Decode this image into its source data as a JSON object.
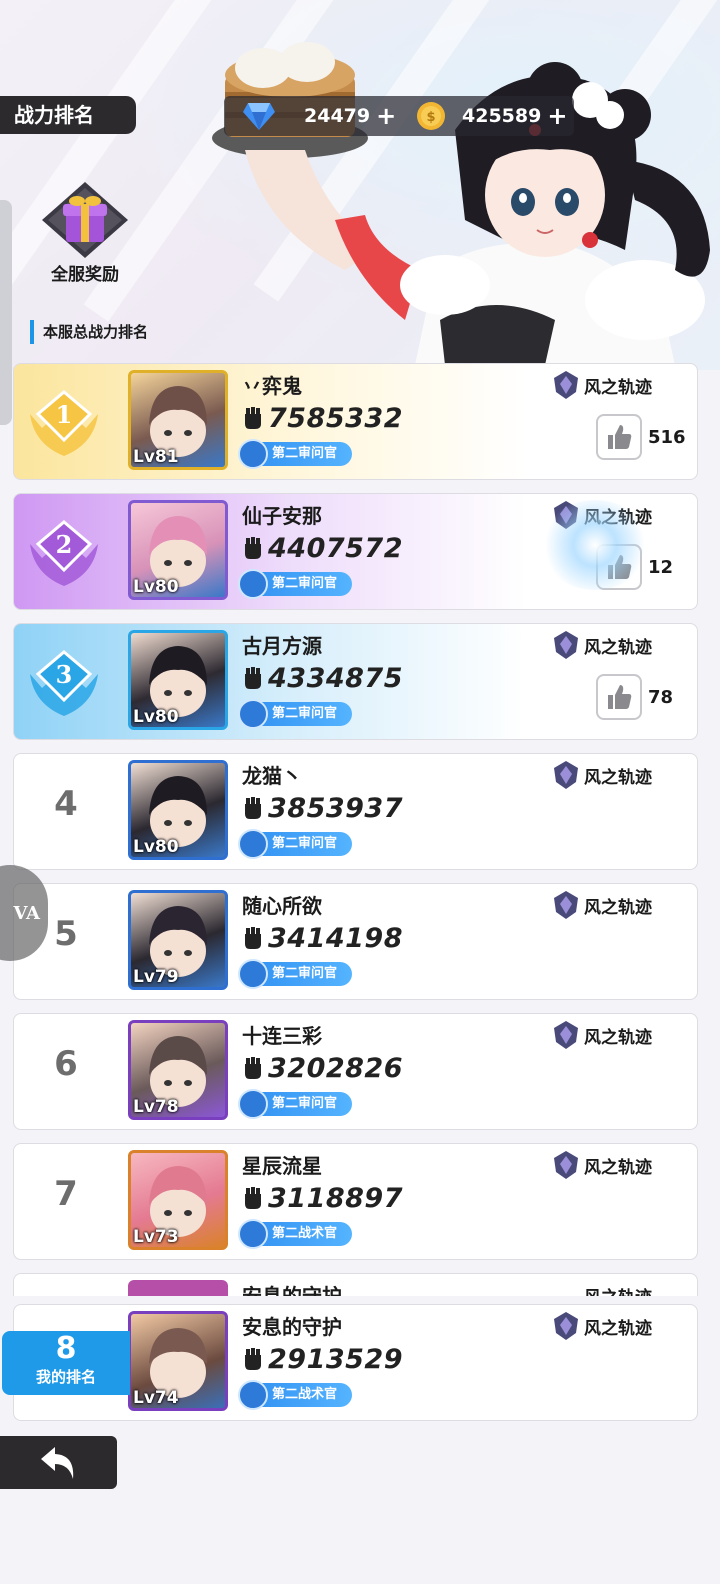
{
  "header": {
    "title": "战力排名",
    "diamonds": "24479",
    "coins": "425589",
    "plus": "+"
  },
  "gift": {
    "label": "全服奖励"
  },
  "section_label": "本服总战力排名",
  "rows": [
    {
      "rank": "1",
      "name": "丷弈鬼",
      "power": "7585332",
      "level": "Lv81",
      "title": "第二审问官",
      "guild": "风之轨迹",
      "likes": "516"
    },
    {
      "rank": "2",
      "name": "仙子安那",
      "power": "4407572",
      "level": "Lv80",
      "title": "第二审问官",
      "guild": "风之轨迹",
      "likes": "12"
    },
    {
      "rank": "3",
      "name": "古月方源",
      "power": "4334875",
      "level": "Lv80",
      "title": "第二审问官",
      "guild": "风之轨迹",
      "likes": "78"
    },
    {
      "rank": "4",
      "name": "龙猫丶",
      "power": "3853937",
      "level": "Lv80",
      "title": "第二审问官",
      "guild": "风之轨迹"
    },
    {
      "rank": "5",
      "name": "随心所欲",
      "power": "3414198",
      "level": "Lv79",
      "title": "第二审问官",
      "guild": "风之轨迹"
    },
    {
      "rank": "6",
      "name": "十连三彩",
      "power": "3202826",
      "level": "Lv78",
      "title": "第二审问官",
      "guild": "风之轨迹"
    },
    {
      "rank": "7",
      "name": "星辰流星",
      "power": "3118897",
      "level": "Lv73",
      "title": "第二战术官",
      "guild": "风之轨迹"
    }
  ],
  "peek_row": {
    "name": "安息的守护",
    "guild": "风之轨迹"
  },
  "my_rank": {
    "rank": "8",
    "label": "我的排名",
    "name": "安息的守护",
    "power": "2913529",
    "level": "Lv74",
    "title": "第二战术官",
    "guild": "风之轨迹"
  },
  "floating_ball": {
    "text": "VA"
  },
  "colors": {
    "accent_blue": "#1e9ae8",
    "rank1": "#f6c543",
    "rank2": "#a35ad8",
    "rank3": "#2aa6e6",
    "dark_bar": "#2c2a2d"
  }
}
